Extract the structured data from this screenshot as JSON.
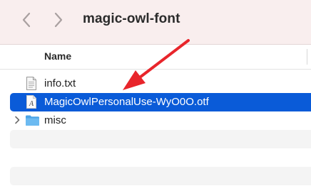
{
  "window": {
    "title": "magic-owl-font"
  },
  "toolbar": {
    "back_icon": "chevron-left-icon",
    "forward_icon": "chevron-right-icon"
  },
  "list": {
    "column_header": "Name",
    "items": [
      {
        "name": "info.txt",
        "icon": "text-file-icon",
        "selected": false
      },
      {
        "name": "MagicOwlPersonalUse-WyO0O.otf",
        "icon": "font-file-icon",
        "selected": true
      },
      {
        "name": "misc",
        "icon": "folder-icon",
        "selected": false,
        "expandable": true
      }
    ]
  },
  "colors": {
    "toolbar_bg": "#f9eeee",
    "selection": "#0a5bd8",
    "folder": "#5fb4ee",
    "annotation_arrow": "#e8252b"
  }
}
